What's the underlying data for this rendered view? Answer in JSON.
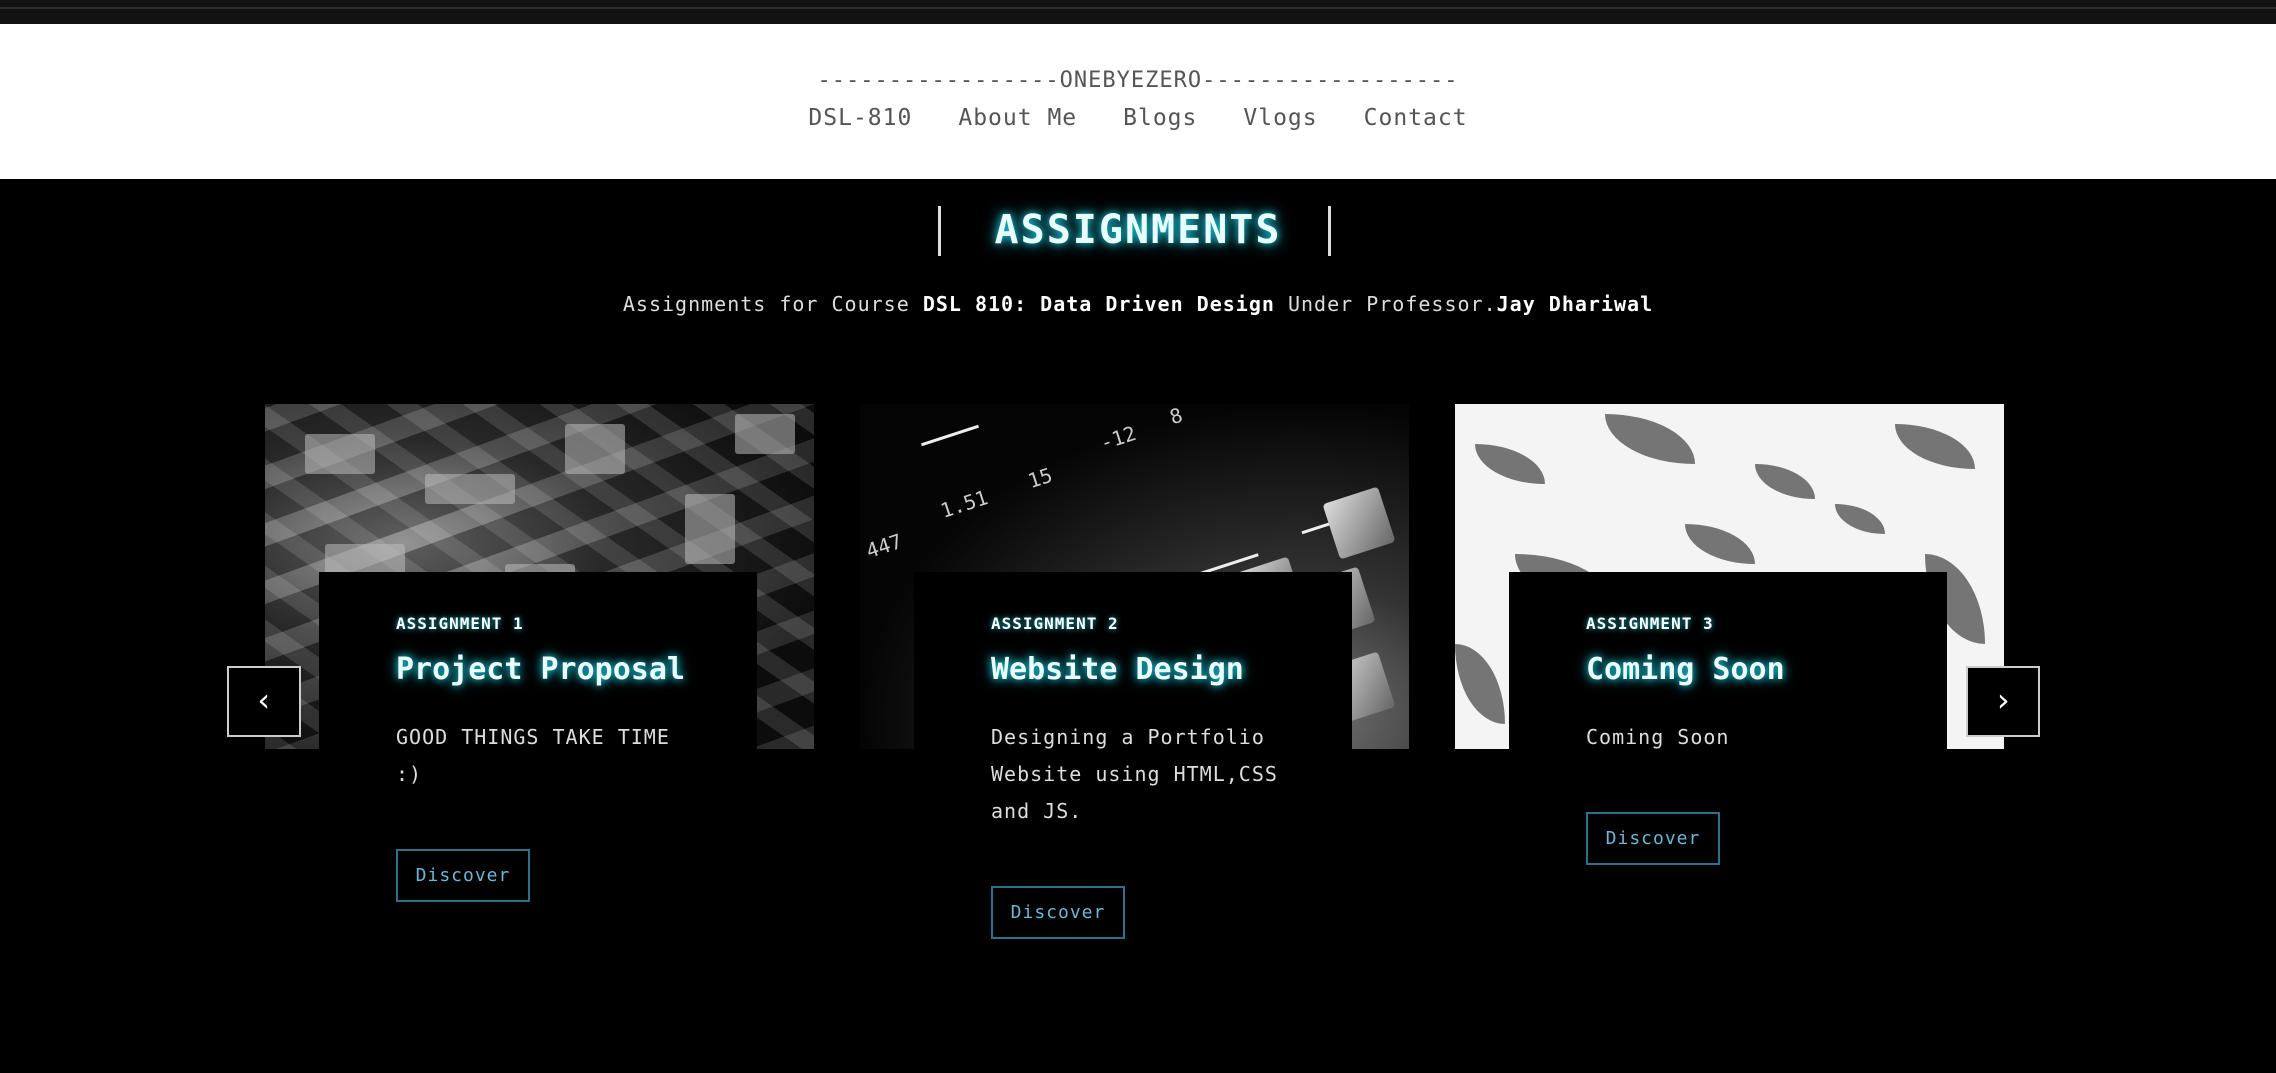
{
  "header": {
    "brand": "-----------------ONEBYEZERO------------------",
    "nav": [
      "DSL-810",
      "About Me",
      "Blogs",
      "Vlogs",
      "Contact"
    ]
  },
  "section": {
    "title": "ASSIGNMENTS",
    "subtitle_prefix": "Assignments for Course ",
    "course": "DSL 810: Data Driven Design",
    "subtitle_middle": " Under Professor.",
    "professor": "Jay Dhariwal"
  },
  "cards": [
    {
      "label": "ASSIGNMENT 1",
      "title": "Project Proposal",
      "description": "GOOD THINGS TAKE TIME :)",
      "button": "Discover"
    },
    {
      "label": "ASSIGNMENT 2",
      "title": "Website Design",
      "description": "Designing a Portfolio Website using HTML,CSS and JS.",
      "button": "Discover"
    },
    {
      "label": "ASSIGNMENT 3",
      "title": "Coming Soon",
      "description": "Coming Soon",
      "button": "Discover"
    }
  ],
  "carousel": {
    "prev": "‹",
    "next": "›"
  },
  "image2_text": {
    "a": "1.51",
    "b": "15",
    "c": "-12",
    "d": "447",
    "e": "8"
  },
  "colors": {
    "glow": "#1fc4d8",
    "button_border": "#2e6f8a",
    "button_text": "#6ab7d8"
  }
}
